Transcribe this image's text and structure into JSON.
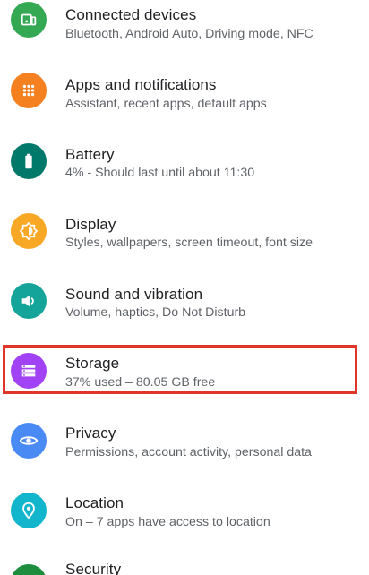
{
  "items": [
    {
      "title": "Connected devices",
      "subtitle": "Bluetooth, Android Auto, Driving mode, NFC",
      "icon": "connected-devices-icon",
      "color": "#34a853"
    },
    {
      "title": "Apps and notifications",
      "subtitle": "Assistant, recent apps, default apps",
      "icon": "apps-grid-icon",
      "color": "#f4801f"
    },
    {
      "title": "Battery",
      "subtitle": "4% - Should last until about 11:30",
      "icon": "battery-icon",
      "color": "#00796b"
    },
    {
      "title": "Display",
      "subtitle": "Styles, wallpapers, screen timeout, font size",
      "icon": "brightness-icon",
      "color": "#f9a825"
    },
    {
      "title": "Sound and vibration",
      "subtitle": "Volume, haptics, Do Not Disturb",
      "icon": "volume-icon",
      "color": "#14a49a"
    },
    {
      "title": "Storage",
      "subtitle": "37% used – 80.05 GB free",
      "icon": "storage-icon",
      "color": "#a142f4"
    },
    {
      "title": "Privacy",
      "subtitle": "Permissions, account activity, personal data",
      "icon": "privacy-eye-icon",
      "color": "#4a8af4"
    },
    {
      "title": "Location",
      "subtitle": "On – 7 apps have access to location",
      "icon": "location-pin-icon",
      "color": "#12b5cb"
    },
    {
      "title": "Security",
      "subtitle": "",
      "icon": "security-icon",
      "color": "#1e8e3e"
    }
  ],
  "highlight_color": "#e0362a"
}
